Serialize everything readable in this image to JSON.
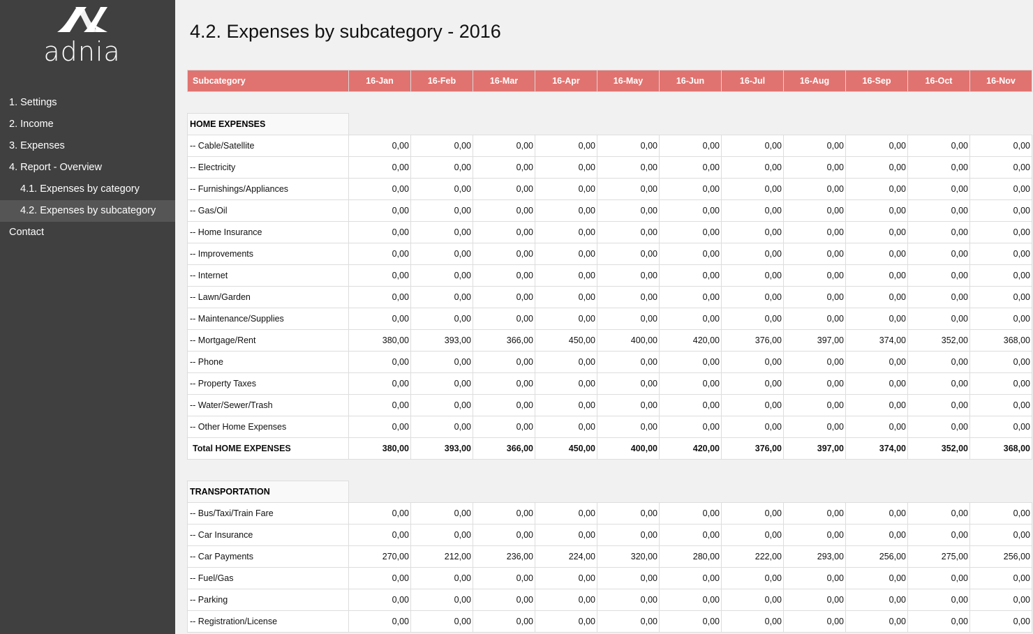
{
  "brand": {
    "name": "adnia"
  },
  "nav": [
    {
      "label": "1. Settings",
      "sub": false,
      "active": false
    },
    {
      "label": "2. Income",
      "sub": false,
      "active": false
    },
    {
      "label": "3. Expenses",
      "sub": false,
      "active": false
    },
    {
      "label": "4. Report - Overview",
      "sub": false,
      "active": false
    },
    {
      "label": "4.1. Expenses by category",
      "sub": true,
      "active": false
    },
    {
      "label": "4.2. Expenses by subcategory",
      "sub": true,
      "active": true
    },
    {
      "label": "Contact",
      "sub": false,
      "active": false
    }
  ],
  "page": {
    "title": "4.2. Expenses by subcategory - 2016"
  },
  "colors": {
    "header": "#e07370",
    "sidebar": "#404040"
  },
  "table": {
    "header": "Subcategory",
    "months": [
      "16-Jan",
      "16-Feb",
      "16-Mar",
      "16-Apr",
      "16-May",
      "16-Jun",
      "16-Jul",
      "16-Aug",
      "16-Sep",
      "16-Oct",
      "16-Nov"
    ],
    "sections": [
      {
        "name": "HOME EXPENSES",
        "rows": [
          {
            "label": "-- Cable/Satellite",
            "values": [
              "0,00",
              "0,00",
              "0,00",
              "0,00",
              "0,00",
              "0,00",
              "0,00",
              "0,00",
              "0,00",
              "0,00",
              "0,00"
            ]
          },
          {
            "label": "-- Electricity",
            "values": [
              "0,00",
              "0,00",
              "0,00",
              "0,00",
              "0,00",
              "0,00",
              "0,00",
              "0,00",
              "0,00",
              "0,00",
              "0,00"
            ]
          },
          {
            "label": "-- Furnishings/Appliances",
            "values": [
              "0,00",
              "0,00",
              "0,00",
              "0,00",
              "0,00",
              "0,00",
              "0,00",
              "0,00",
              "0,00",
              "0,00",
              "0,00"
            ]
          },
          {
            "label": "-- Gas/Oil",
            "values": [
              "0,00",
              "0,00",
              "0,00",
              "0,00",
              "0,00",
              "0,00",
              "0,00",
              "0,00",
              "0,00",
              "0,00",
              "0,00"
            ]
          },
          {
            "label": "-- Home Insurance",
            "values": [
              "0,00",
              "0,00",
              "0,00",
              "0,00",
              "0,00",
              "0,00",
              "0,00",
              "0,00",
              "0,00",
              "0,00",
              "0,00"
            ]
          },
          {
            "label": "-- Improvements",
            "values": [
              "0,00",
              "0,00",
              "0,00",
              "0,00",
              "0,00",
              "0,00",
              "0,00",
              "0,00",
              "0,00",
              "0,00",
              "0,00"
            ]
          },
          {
            "label": "-- Internet",
            "values": [
              "0,00",
              "0,00",
              "0,00",
              "0,00",
              "0,00",
              "0,00",
              "0,00",
              "0,00",
              "0,00",
              "0,00",
              "0,00"
            ]
          },
          {
            "label": "-- Lawn/Garden",
            "values": [
              "0,00",
              "0,00",
              "0,00",
              "0,00",
              "0,00",
              "0,00",
              "0,00",
              "0,00",
              "0,00",
              "0,00",
              "0,00"
            ]
          },
          {
            "label": "-- Maintenance/Supplies",
            "values": [
              "0,00",
              "0,00",
              "0,00",
              "0,00",
              "0,00",
              "0,00",
              "0,00",
              "0,00",
              "0,00",
              "0,00",
              "0,00"
            ]
          },
          {
            "label": "-- Mortgage/Rent",
            "values": [
              "380,00",
              "393,00",
              "366,00",
              "450,00",
              "400,00",
              "420,00",
              "376,00",
              "397,00",
              "374,00",
              "352,00",
              "368,00"
            ]
          },
          {
            "label": "-- Phone",
            "values": [
              "0,00",
              "0,00",
              "0,00",
              "0,00",
              "0,00",
              "0,00",
              "0,00",
              "0,00",
              "0,00",
              "0,00",
              "0,00"
            ]
          },
          {
            "label": "-- Property Taxes",
            "values": [
              "0,00",
              "0,00",
              "0,00",
              "0,00",
              "0,00",
              "0,00",
              "0,00",
              "0,00",
              "0,00",
              "0,00",
              "0,00"
            ]
          },
          {
            "label": "-- Water/Sewer/Trash",
            "values": [
              "0,00",
              "0,00",
              "0,00",
              "0,00",
              "0,00",
              "0,00",
              "0,00",
              "0,00",
              "0,00",
              "0,00",
              "0,00"
            ]
          },
          {
            "label": "-- Other Home Expenses",
            "values": [
              "0,00",
              "0,00",
              "0,00",
              "0,00",
              "0,00",
              "0,00",
              "0,00",
              "0,00",
              "0,00",
              "0,00",
              "0,00"
            ]
          }
        ],
        "total": {
          "label": "Total HOME EXPENSES",
          "values": [
            "380,00",
            "393,00",
            "366,00",
            "450,00",
            "400,00",
            "420,00",
            "376,00",
            "397,00",
            "374,00",
            "352,00",
            "368,00"
          ]
        }
      },
      {
        "name": "TRANSPORTATION",
        "rows": [
          {
            "label": "-- Bus/Taxi/Train Fare",
            "values": [
              "0,00",
              "0,00",
              "0,00",
              "0,00",
              "0,00",
              "0,00",
              "0,00",
              "0,00",
              "0,00",
              "0,00",
              "0,00"
            ]
          },
          {
            "label": "-- Car Insurance",
            "values": [
              "0,00",
              "0,00",
              "0,00",
              "0,00",
              "0,00",
              "0,00",
              "0,00",
              "0,00",
              "0,00",
              "0,00",
              "0,00"
            ]
          },
          {
            "label": "-- Car Payments",
            "values": [
              "270,00",
              "212,00",
              "236,00",
              "224,00",
              "320,00",
              "280,00",
              "222,00",
              "293,00",
              "256,00",
              "275,00",
              "256,00"
            ]
          },
          {
            "label": "-- Fuel/Gas",
            "values": [
              "0,00",
              "0,00",
              "0,00",
              "0,00",
              "0,00",
              "0,00",
              "0,00",
              "0,00",
              "0,00",
              "0,00",
              "0,00"
            ]
          },
          {
            "label": "-- Parking",
            "values": [
              "0,00",
              "0,00",
              "0,00",
              "0,00",
              "0,00",
              "0,00",
              "0,00",
              "0,00",
              "0,00",
              "0,00",
              "0,00"
            ]
          },
          {
            "label": "-- Registration/License",
            "values": [
              "0,00",
              "0,00",
              "0,00",
              "0,00",
              "0,00",
              "0,00",
              "0,00",
              "0,00",
              "0,00",
              "0,00",
              "0,00"
            ]
          }
        ]
      }
    ]
  }
}
